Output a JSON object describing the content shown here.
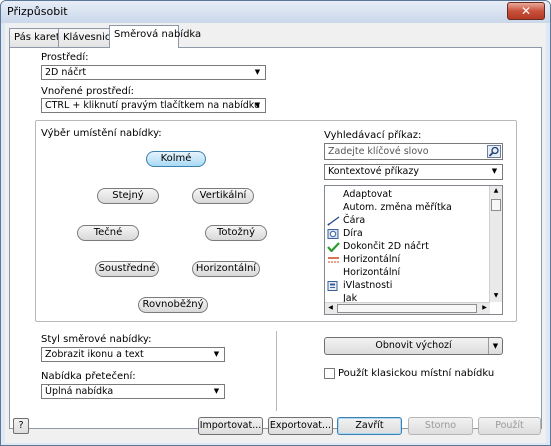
{
  "window": {
    "title": "Přizpůsobit",
    "close_glyph": "✕"
  },
  "tabs": [
    {
      "label": "Pás karet"
    },
    {
      "label": "Klávesnice"
    },
    {
      "label": "Směrová nabídka"
    }
  ],
  "environment": {
    "label": "Prostředí:",
    "value": "2D náčrt",
    "nested_label": "Vnořené prostředí:",
    "nested_value": "CTRL + kliknutí pravým tlačítkem na nabídku"
  },
  "menu_location": {
    "label": "Výběr umístění nabídky:",
    "buttons": {
      "kolme": "Kolmé",
      "stejny": "Stejný",
      "vertikalni": "Vertikální",
      "tecne": "Tečné",
      "totozny": "Totožný",
      "soustredne": "Soustředné",
      "horizontalni": "Horizontální",
      "rovnobezny": "Rovnoběžný"
    }
  },
  "command_search": {
    "label": "Vyhledávací příkaz:",
    "placeholder": "Zadejte klíčové slovo",
    "filter_value": "Kontextové příkazy",
    "items": [
      {
        "label": "Adaptovat",
        "icon": "none"
      },
      {
        "label": "Autom. změna měřítka",
        "icon": "none"
      },
      {
        "label": "Čára",
        "icon": "line-icon"
      },
      {
        "label": "Díra",
        "icon": "hole-icon"
      },
      {
        "label": "Dokončit 2D náčrt",
        "icon": "checkmark-icon"
      },
      {
        "label": "Horizontální",
        "icon": "horizontal-constraint-icon"
      },
      {
        "label": "Horizontální",
        "icon": "none"
      },
      {
        "label": "iVlastnosti",
        "icon": "properties-icon"
      },
      {
        "label": "Jak",
        "icon": "none"
      }
    ]
  },
  "marking_style": {
    "label": "Styl směrové nabídky:",
    "value": "Zobrazit ikonu a text",
    "overflow_label": "Nabídka přetečení:",
    "overflow_value": "Úplná nabídka"
  },
  "restore": {
    "label": "Obnovit výchozí"
  },
  "classic_menu": {
    "label": "Použít klasickou místní nabídku",
    "checked": false
  },
  "footer": {
    "help_glyph": "?",
    "import": "Importovat...",
    "export": "Exportovat...",
    "close": "Zavřít",
    "cancel": "Storno",
    "apply": "Použít"
  }
}
